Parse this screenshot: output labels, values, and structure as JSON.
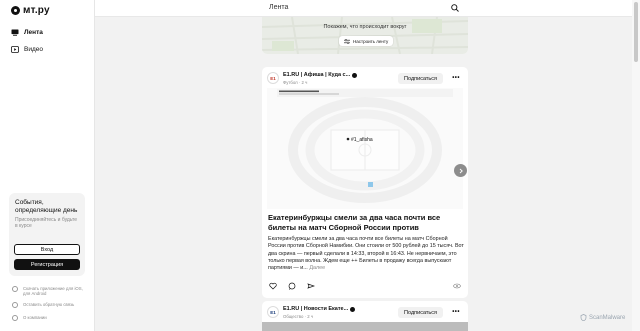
{
  "app": {
    "logo_text": "мт.ру"
  },
  "sidebar": {
    "nav": [
      {
        "label": "Лента",
        "icon": "monitor-icon",
        "active": true
      },
      {
        "label": "Видео",
        "icon": "play-icon",
        "active": false
      }
    ],
    "promo": {
      "title": "События, определяющие день",
      "subtitle": "Присоединяйтесь и будьте в курсе",
      "login_label": "Вход",
      "register_label": "Регистрация"
    },
    "links": [
      {
        "text": "Скачать приложение для iOS, для Android",
        "icon": "phone-icon"
      },
      {
        "text": "Оставить обратную связь",
        "icon": "feedback-icon"
      },
      {
        "text": "О компании",
        "icon": "info-icon"
      }
    ]
  },
  "header": {
    "title": "Лента",
    "search_icon": "search-icon"
  },
  "map_card": {
    "caption": "Покажем, что происходит вокруг",
    "button_label": "Настроить ленту"
  },
  "posts": [
    {
      "source": "E1.RU | Афиша | Куда с...",
      "avatar_text": "E1",
      "category": "Футбол",
      "time": "2 ч",
      "subscribe_label": "Подписаться",
      "media_text": "#1_afisha",
      "title": "Екатеринбуржцы смели за два часа почти все билеты на матч Сборной России против",
      "body": "Екатеринбуржцы смели за два часа почти все билеты на матч Сборной России против Сборной Намибии. Они стоили от 500 рублей до 15 тысяч. Вот два скрина — первый сделали в 14:33, второй в 16:43. Не нервничаем, это только первая волна. Ждем еще ++ Билеты в продажу всегда выпускают партиями — и...",
      "more_label": "Далее"
    },
    {
      "source": "E1.RU | Новости Екате...",
      "avatar_text": "E1",
      "category": "Общество",
      "time": "2 ч",
      "subscribe_label": "Подписаться"
    }
  ],
  "watermark": "ScanMalware",
  "colors": {
    "accent": "#111111",
    "sidebar_bg": "#ffffff",
    "page_bg": "#f2f2f2"
  }
}
